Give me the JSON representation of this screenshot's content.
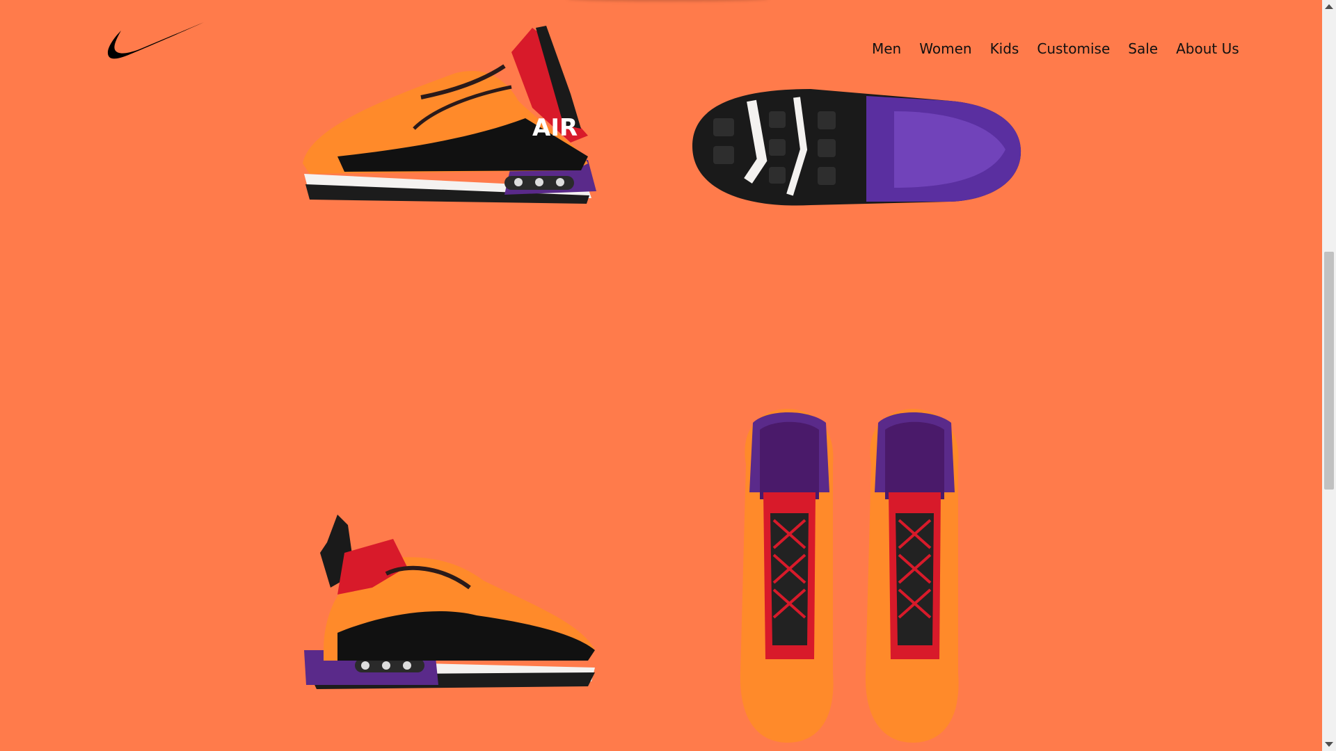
{
  "brand": {
    "logo_icon": "nike-swoosh-icon",
    "color": "#000000"
  },
  "nav": {
    "items": [
      {
        "label": "Men"
      },
      {
        "label": "Women"
      },
      {
        "label": "Kids"
      },
      {
        "label": "Customise"
      },
      {
        "label": "Sale"
      },
      {
        "label": "About Us"
      }
    ]
  },
  "theme": {
    "background": "#ff7b4b",
    "shoe_orange": "#ff8a2a",
    "shoe_purple": "#5a2a8a",
    "shoe_red": "#d81a2a",
    "shoe_black": "#111111"
  },
  "gallery": {
    "images": [
      {
        "name": "shoe-side-view"
      },
      {
        "name": "shoe-sole-view"
      },
      {
        "name": "shoe-medial-view"
      },
      {
        "name": "shoe-top-view"
      }
    ]
  }
}
